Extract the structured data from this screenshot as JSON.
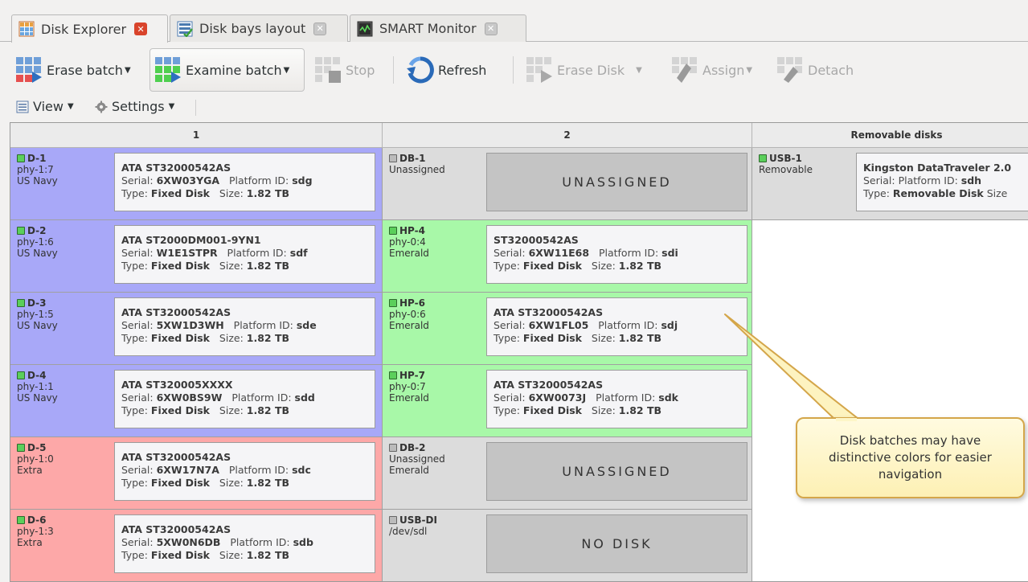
{
  "tabs": [
    {
      "label": "Disk Explorer",
      "icon": "disk-explorer-icon",
      "active": true
    },
    {
      "label": "Disk bays layout",
      "icon": "bays-layout-icon",
      "active": false
    },
    {
      "label": "SMART Monitor",
      "icon": "smart-monitor-icon",
      "active": false
    }
  ],
  "toolbar": {
    "erase_batch": "Erase batch",
    "examine_batch": "Examine batch",
    "stop": "Stop",
    "refresh": "Refresh",
    "erase_disk": "Erase Disk",
    "assign": "Assign",
    "detach": "Detach"
  },
  "toolbar2": {
    "view": "View",
    "settings": "Settings"
  },
  "columns": {
    "c1": "1",
    "c2": "2",
    "c3": "Removable disks"
  },
  "labels": {
    "serial": "Serial:",
    "platform_id": "Platform ID:",
    "type": "Type:",
    "size": "Size:"
  },
  "col1": [
    {
      "slot": "D-1",
      "port": "phy-1:7",
      "batch": "US Navy",
      "model": "ATA ST32000542AS",
      "serial": "6XW03YGA",
      "platform": "sdg",
      "type": "Fixed Disk",
      "size": "1.82 TB"
    },
    {
      "slot": "D-2",
      "port": "phy-1:6",
      "batch": "US Navy",
      "model": "ATA ST2000DM001-9YN1",
      "serial": "W1E1STPR",
      "platform": "sdf",
      "type": "Fixed Disk",
      "size": "1.82 TB"
    },
    {
      "slot": "D-3",
      "port": "phy-1:5",
      "batch": "US Navy",
      "model": "ATA ST32000542AS",
      "serial": "5XW1D3WH",
      "platform": "sde",
      "type": "Fixed Disk",
      "size": "1.82 TB"
    },
    {
      "slot": "D-4",
      "port": "phy-1:1",
      "batch": "US Navy",
      "model": "ATA ST320005XXXX",
      "serial": "6XW0BS9W",
      "platform": "sdd",
      "type": "Fixed Disk",
      "size": "1.82 TB"
    },
    {
      "slot": "D-5",
      "port": "phy-1:0",
      "batch": "Extra",
      "model": "ATA ST32000542AS",
      "serial": "6XW17N7A",
      "platform": "sdc",
      "type": "Fixed Disk",
      "size": "1.82 TB"
    },
    {
      "slot": "D-6",
      "port": "phy-1:3",
      "batch": "Extra",
      "model": "ATA ST32000542AS",
      "serial": "5XW0N6DB",
      "platform": "sdb",
      "type": "Fixed Disk",
      "size": "1.82 TB"
    }
  ],
  "col2": [
    {
      "slot": "DB-1",
      "line1": "Unassigned",
      "line2": "",
      "empty": "UNASSIGNED"
    },
    {
      "slot": "HP-4",
      "line1": "phy-0:4",
      "line2": "Emerald",
      "model": "ST32000542AS",
      "serial": "6XW11E68",
      "platform": "sdi",
      "type": "Fixed Disk",
      "size": "1.82 TB"
    },
    {
      "slot": "HP-6",
      "line1": "phy-0:6",
      "line2": "Emerald",
      "model": "ATA ST32000542AS",
      "serial": "6XW1FL05",
      "platform": "sdj",
      "type": "Fixed Disk",
      "size": "1.82 TB"
    },
    {
      "slot": "HP-7",
      "line1": "phy-0:7",
      "line2": "Emerald",
      "model": "ATA ST32000542AS",
      "serial": "6XW0073J",
      "platform": "sdk",
      "type": "Fixed Disk",
      "size": "1.82 TB"
    },
    {
      "slot": "DB-2",
      "line1": "Unassigned",
      "line2": "Emerald",
      "empty": "UNASSIGNED"
    },
    {
      "slot": "USB-DI",
      "line1": "/dev/sdl",
      "line2": "",
      "empty": "NO DISK"
    }
  ],
  "col3": [
    {
      "slot": "USB-1",
      "line1": "Removable",
      "model": "Kingston DataTraveler 2.0",
      "serial_label": "Serial:",
      "platform_label": "Platform ID:",
      "platform": "sdh",
      "type": "Removable Disk",
      "size_label": "Size"
    }
  ],
  "callout": "Disk batches may have distinctive colors for easier navigation",
  "colors": {
    "us_navy": "#a8a8f8",
    "extra": "#fda8a8",
    "emerald": "#a8f8a8",
    "unassigned": "#dcdcdc",
    "callout_border": "#d4a64a"
  }
}
